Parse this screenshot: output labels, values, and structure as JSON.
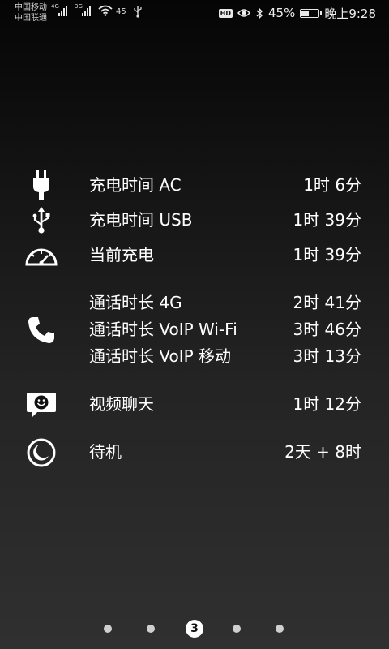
{
  "status_bar": {
    "carrier_1": "中国移动",
    "carrier_2": "中国联通",
    "net_1": "4G",
    "net_2": "3G",
    "battery_small": "45",
    "battery_pct": "45%",
    "battery_level": 0.45,
    "time": "晚上9:28",
    "hd_label": "HD"
  },
  "stats": {
    "charge_ac": {
      "label": "充电时间 AC",
      "value": "1时 6分",
      "icon": "plug-icon"
    },
    "charge_usb": {
      "label": "充电时间 USB",
      "value": "1时 39分",
      "icon": "usb-icon"
    },
    "current_charge": {
      "label": "当前充电",
      "value": "1时 39分",
      "icon": "speedometer-icon"
    },
    "call": {
      "icon": "phone-icon",
      "lines": [
        {
          "label": "通话时长 4G",
          "value": "2时 41分"
        },
        {
          "label": "通话时长 VoIP Wi-Fi",
          "value": "3时 46分"
        },
        {
          "label": "通话时长 VoIP 移动",
          "value": "3时 13分"
        }
      ]
    },
    "video_chat": {
      "label": "视频聊天",
      "value": "1时 12分",
      "icon": "video-chat-icon"
    },
    "standby": {
      "label": "待机",
      "value": "2天 + 8时",
      "icon": "moon-icon"
    }
  },
  "pager": {
    "active_page": "3",
    "page_count": 5
  }
}
